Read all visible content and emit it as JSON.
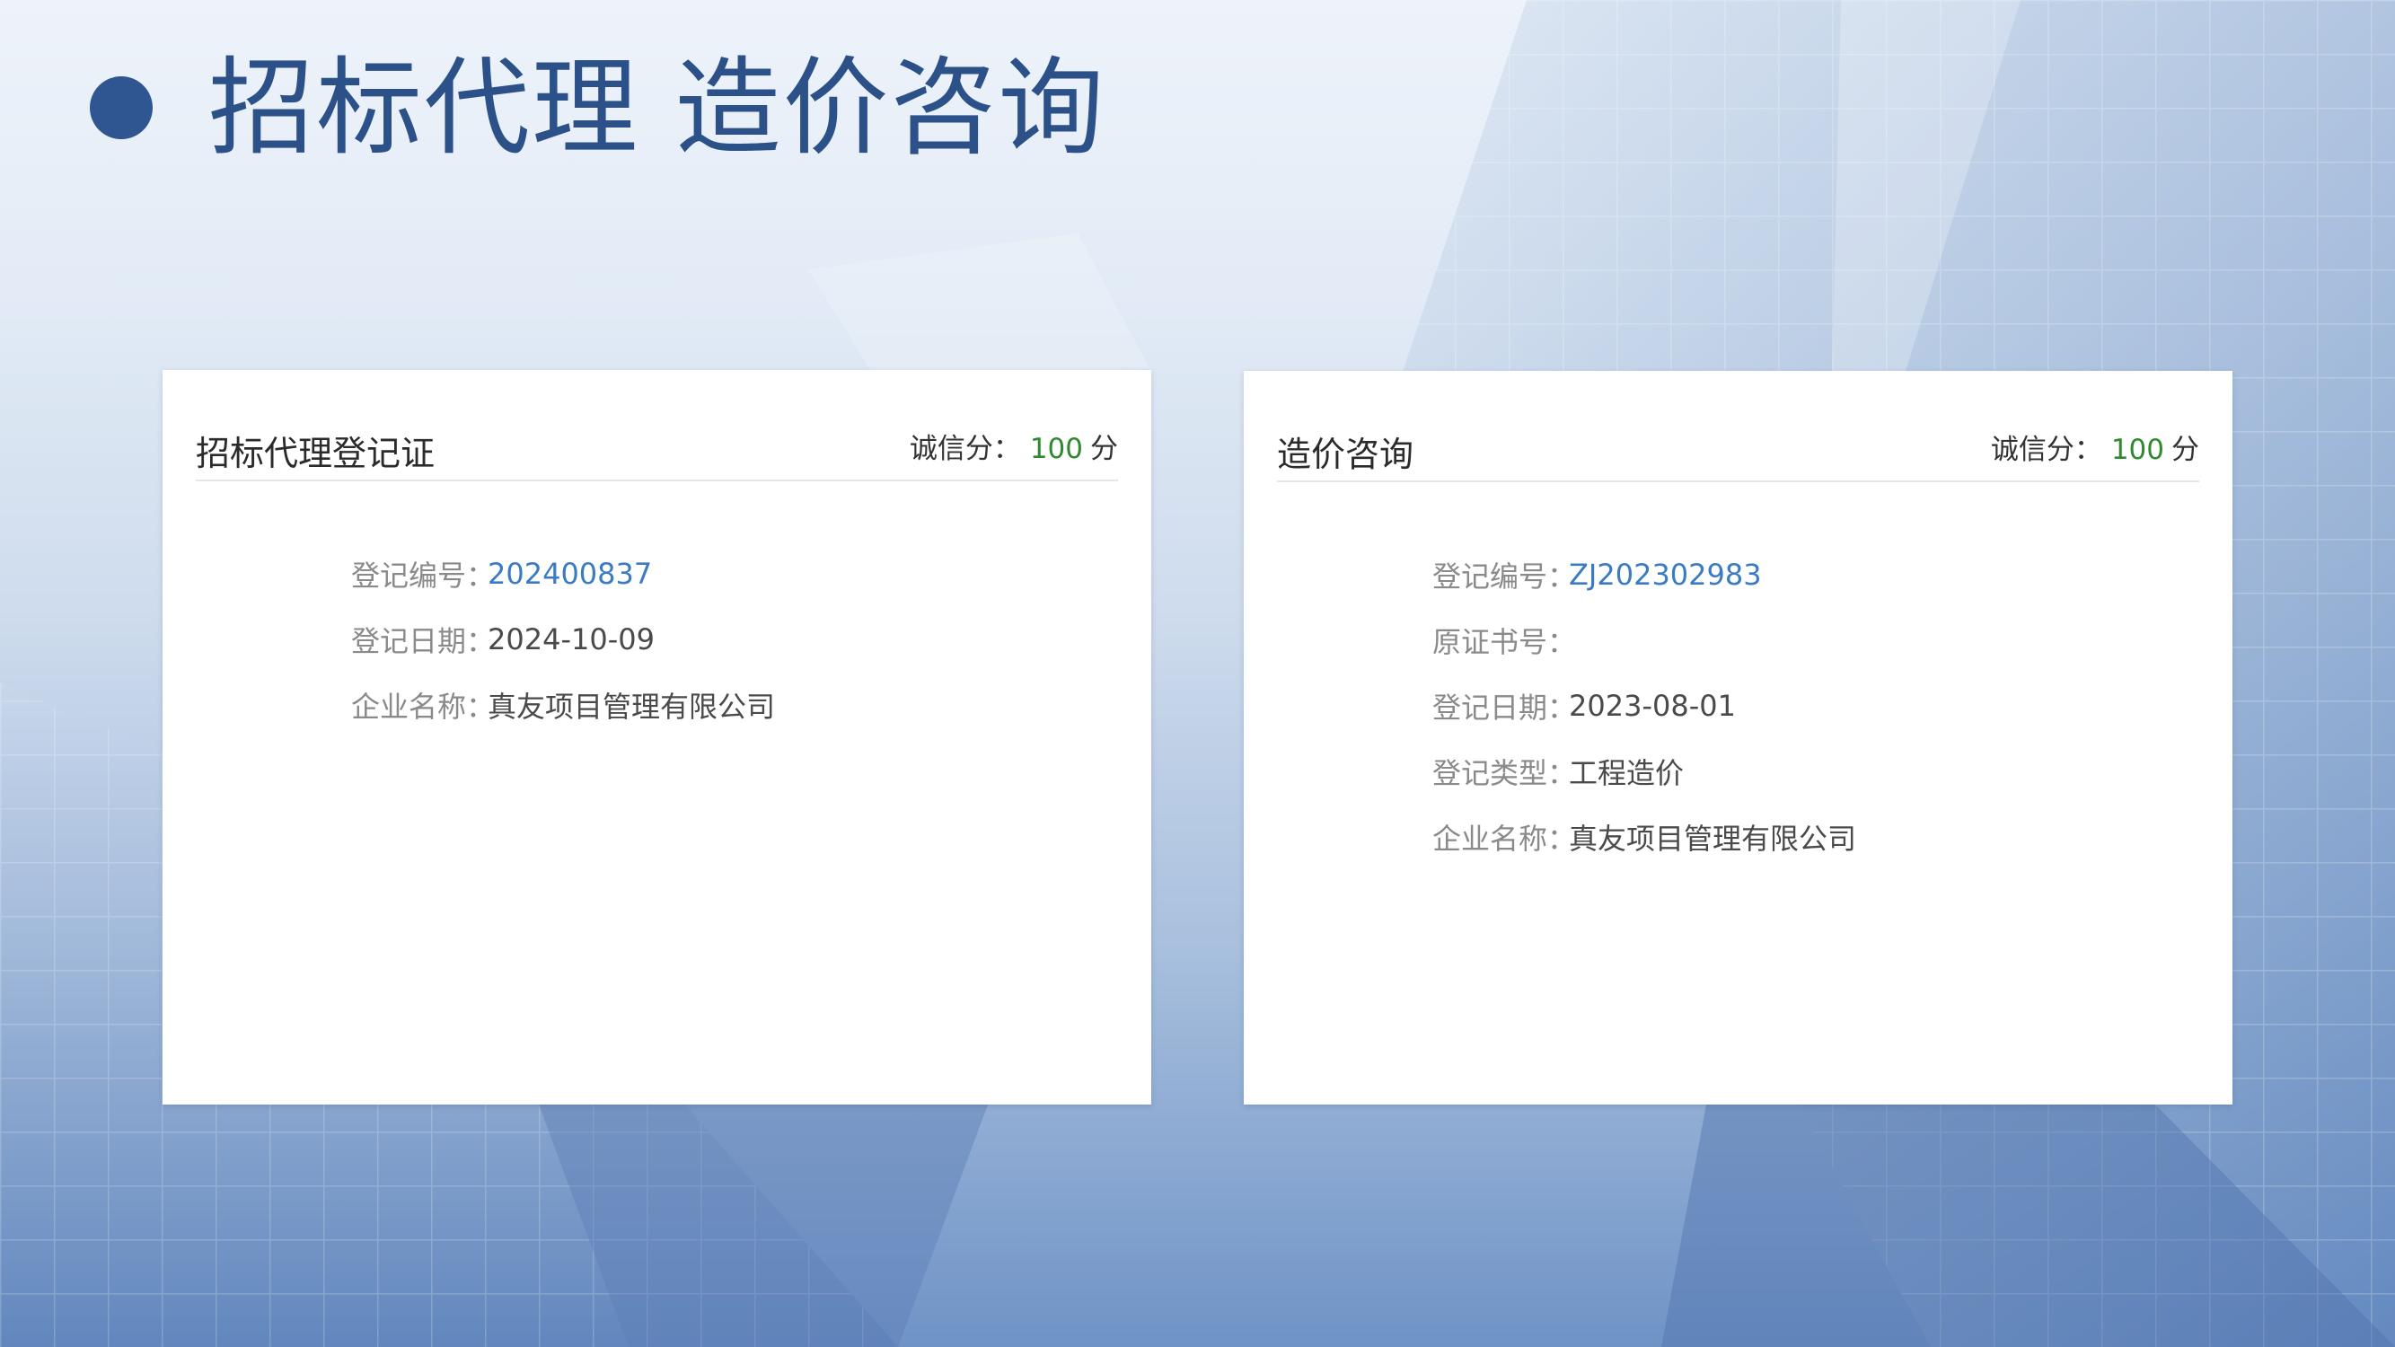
{
  "page": {
    "title": "招标代理 造价咨询",
    "colors": {
      "title": "#2c5189",
      "bullet": "#2f5690",
      "credit_score": "#2f8a2f",
      "link_value": "#3b7bc4"
    }
  },
  "cards": [
    {
      "title": "招标代理登记证",
      "credit_label": "诚信分：",
      "credit_value": "100",
      "credit_unit": "分",
      "fields": [
        {
          "label": "登记编号：",
          "value": "202400837"
        },
        {
          "label": "登记日期：",
          "value": "2024-10-09"
        },
        {
          "label": "企业名称：",
          "value": "真友项目管理有限公司"
        }
      ]
    },
    {
      "title": "造价咨询",
      "credit_label": "诚信分：",
      "credit_value": "100",
      "credit_unit": "分",
      "fields": [
        {
          "label": "登记编号：",
          "value": "ZJ202302983"
        },
        {
          "label": "原证书号：",
          "value": ""
        },
        {
          "label": "登记日期：",
          "value": "2023-08-01"
        },
        {
          "label": "登记类型：",
          "value": "工程造价"
        },
        {
          "label": "企业名称：",
          "value": "真友项目管理有限公司"
        }
      ]
    }
  ]
}
